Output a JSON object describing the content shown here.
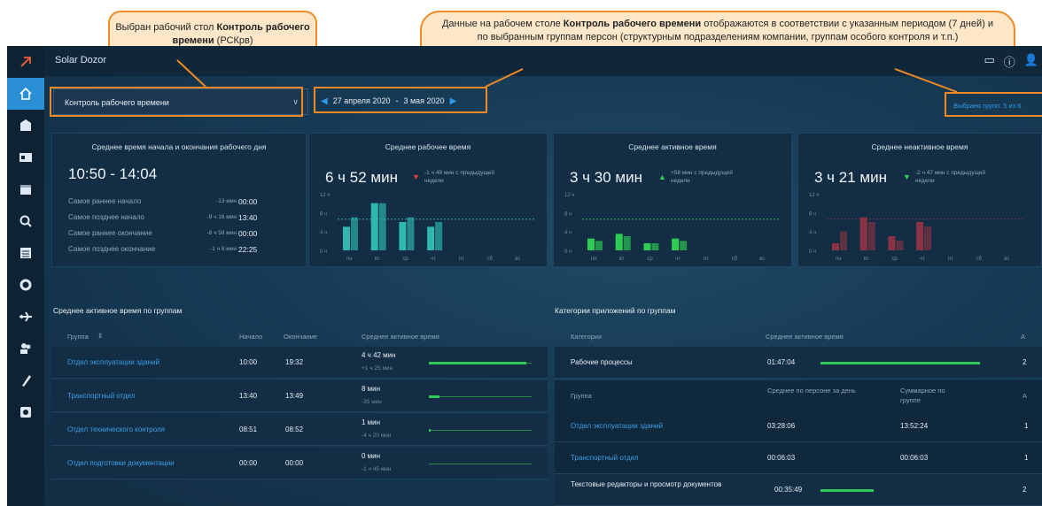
{
  "callouts": {
    "left": {
      "prefix": "Выбран рабочий стол ",
      "bold": "Контроль рабочего времени",
      "suffix": " (РСКрв)"
    },
    "right": {
      "prefix": "Данные на рабочем столе ",
      "bold": "Контроль рабочего времени",
      "suffix": " отображаются в соответствии с указанным периодом (7 дней) и по выбранным группам персон (структурным подразделениям компании, группам особого контроля и т.п.)"
    }
  },
  "app": {
    "brand": "Solar Dozor"
  },
  "controls": {
    "workspace": "Контроль рабочего времени",
    "date_from": "27 апреля 2020",
    "date_sep": "-",
    "date_to": "3 мая 2020",
    "groups_selected": "Выбрано групп: 5 из 6"
  },
  "sidebar": {
    "items": [
      "home-icon",
      "building-icon",
      "id-card-icon",
      "calendar-icon",
      "search-icon",
      "list-icon",
      "gear-badge-icon",
      "plane-icon",
      "users-icon",
      "brush-icon",
      "settings-icon"
    ]
  },
  "cards": {
    "workday": {
      "title": "Среднее время начала и окончания рабочего дня",
      "value": "10:50 - 14:04",
      "rows": [
        {
          "label": "Самое раннее начало",
          "delta": "-13 мин",
          "value": "00:00"
        },
        {
          "label": "Самое позднее начало",
          "delta": "-9 ч 16 мин",
          "value": "13:40"
        },
        {
          "label": "Самое раннее окончание",
          "delta": "-8 ч 58 мин",
          "value": "00:00"
        },
        {
          "label": "Самое позднее окончание",
          "delta": "-1 ч 8 мин",
          "value": "22:25"
        }
      ]
    },
    "working": {
      "title": "Среднее рабочее время",
      "value": "6 ч 52 мин",
      "delta": "-1 ч 49 мин с предыдущей недели",
      "trend": "down"
    },
    "active": {
      "title": "Среднее активное время",
      "value": "3 ч 30 мин",
      "delta": "+58 мин с предыдущей недели",
      "trend": "up"
    },
    "inactive": {
      "title": "Среднее неактивное время",
      "value": "3 ч 21 мин",
      "delta": "-2 ч 47 мин с предыдущей недели",
      "trend": "down"
    }
  },
  "chart_days": [
    "пн",
    "вт",
    "ср",
    "чт",
    "пт",
    "сб",
    "вс"
  ],
  "chart_ticks": [
    "12 ч",
    "8 ч",
    "4 ч",
    "0 ч"
  ],
  "chart_data": [
    {
      "type": "bar",
      "categories": [
        "пн",
        "вт",
        "ср",
        "чт",
        "пт",
        "сб",
        "вс"
      ],
      "series": [
        {
          "values": [
            5,
            10,
            6,
            5,
            0,
            0,
            0
          ]
        },
        {
          "values": [
            7,
            10,
            7,
            6,
            0,
            0,
            0
          ]
        }
      ],
      "ylim": [
        0,
        12
      ],
      "color": "#2fb8b0"
    },
    {
      "type": "bar",
      "categories": [
        "пн",
        "вт",
        "ср",
        "чт",
        "пт",
        "сб",
        "вс"
      ],
      "series": [
        {
          "values": [
            2.5,
            3.5,
            1.5,
            2.5,
            0,
            0,
            0
          ]
        },
        {
          "values": [
            2,
            3,
            1.5,
            2,
            0,
            0,
            0
          ]
        }
      ],
      "ylim": [
        0,
        12
      ],
      "color": "#2ecc55"
    },
    {
      "type": "bar",
      "categories": [
        "пн",
        "вт",
        "ср",
        "чт",
        "пт",
        "сб",
        "вс"
      ],
      "series": [
        {
          "values": [
            1.5,
            7,
            3,
            6,
            0,
            0,
            0
          ]
        },
        {
          "values": [
            4,
            6,
            2,
            5,
            0,
            0,
            0
          ]
        }
      ],
      "ylim": [
        0,
        12
      ],
      "color": "#8a3344"
    }
  ],
  "groups": {
    "title": "Среднее активное время по группам",
    "headers": {
      "group": "Группа",
      "start": "Начало",
      "end": "Окончание",
      "avg": "Среднее активное время"
    },
    "rows": [
      {
        "name": "Отдел эксплуатации зданий",
        "start": "10:00",
        "end": "19:32",
        "avg": "4 ч 42 мин",
        "delta": "+1 ч 25 мин",
        "fill": 0.95
      },
      {
        "name": "Транспортный отдел",
        "start": "13:40",
        "end": "13:49",
        "avg": "8 мин",
        "delta": "-35 мин",
        "fill": 0.1
      },
      {
        "name": "Отдел технического контроля",
        "start": "08:51",
        "end": "08:52",
        "avg": "1 мин",
        "delta": "-4 ч 20 мин",
        "fill": 0.02
      },
      {
        "name": "Отдел подготовки документации",
        "start": "00:00",
        "end": "00:00",
        "avg": "0 мин",
        "delta": "-1 ч 45 мин",
        "fill": 0
      }
    ]
  },
  "categories": {
    "title": "Категории приложений по группам",
    "headers": {
      "category": "Категория",
      "avg": "Среднее активное время",
      "count": "А"
    },
    "top": {
      "name": "Рабочие процессы",
      "avg": "01:47:04",
      "count": "2"
    },
    "sub_headers": {
      "group": "Группа",
      "per_person": "Среднее по персоне за день",
      "total": "Суммарное по группе",
      "count": "А"
    },
    "sub_rows": [
      {
        "name": "Отдел эксплуатации зданий",
        "per_person": "03:28:06",
        "total": "13:52:24",
        "count": "1"
      },
      {
        "name": "Транспортный отдел",
        "per_person": "00:06:03",
        "total": "00:06:03",
        "count": "1"
      }
    ],
    "bottom": {
      "name": "Текстовые редакторы и просмотр документов",
      "avg": "00:35:49",
      "count": "2"
    }
  }
}
